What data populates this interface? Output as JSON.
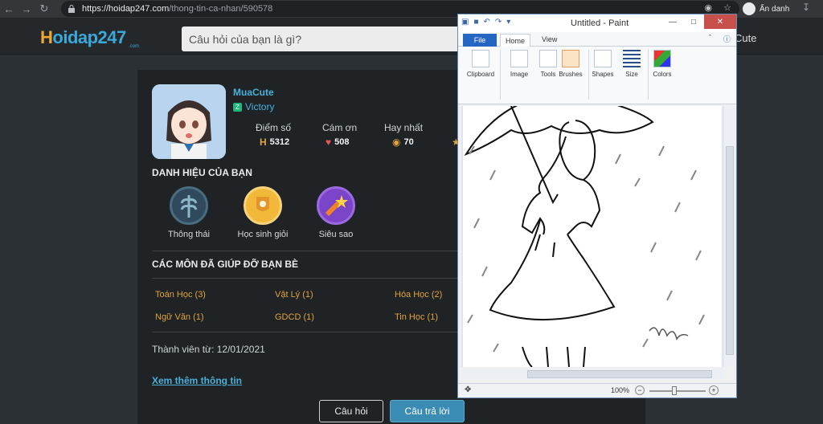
{
  "browser": {
    "url_host": "https://hoidap247.com",
    "url_path": "/thong-tin-ca-nhan/590578",
    "incognito_label": "Ẩn danh"
  },
  "header": {
    "logo_h": "H",
    "logo_rest": "oidap247",
    "logo_sub": ".com",
    "search_placeholder": "Câu hỏi của bạn là gì?",
    "user_name_partial": "Cute"
  },
  "profile": {
    "username": "MuaCute",
    "rank": "Victory",
    "stats": [
      {
        "label": "Điểm số",
        "value": "5312",
        "icon": "points-icon"
      },
      {
        "label": "Cám ơn",
        "value": "508",
        "icon": "heart-icon"
      },
      {
        "label": "Hay nhất",
        "value": "70",
        "icon": "medal-icon"
      }
    ]
  },
  "badges": {
    "title": "DANH HIỆU CỦA BẠN",
    "items": [
      {
        "label": "Thông thái",
        "color": "#2f4a5c"
      },
      {
        "label": "Học sinh giỏi",
        "color": "#f2b83a"
      },
      {
        "label": "Siêu sao",
        "color": "#7a45c8"
      }
    ]
  },
  "subjects": {
    "title": "CÁC MÔN ĐÃ GIÚP ĐỠ BẠN BÈ",
    "items": [
      "Toán Học (3)",
      "Vật Lý (1)",
      "Hóa Học (2)",
      "Ngữ Văn (1)",
      "GDCD (1)",
      "Tin Học (1)"
    ]
  },
  "member_since": "Thành viên từ: 12/01/2021",
  "more_link": "Xem thêm thông tin",
  "buttons": {
    "question": "Câu hỏi",
    "answer": "Câu trả lời"
  },
  "paint": {
    "title": "Untitled - Paint",
    "tabs": {
      "file": "File",
      "home": "Home",
      "view": "View"
    },
    "groups": [
      "Clipboard",
      "Image",
      "Tools",
      "Brushes",
      "Shapes",
      "Size",
      "Colors"
    ],
    "zoom": "100%"
  }
}
